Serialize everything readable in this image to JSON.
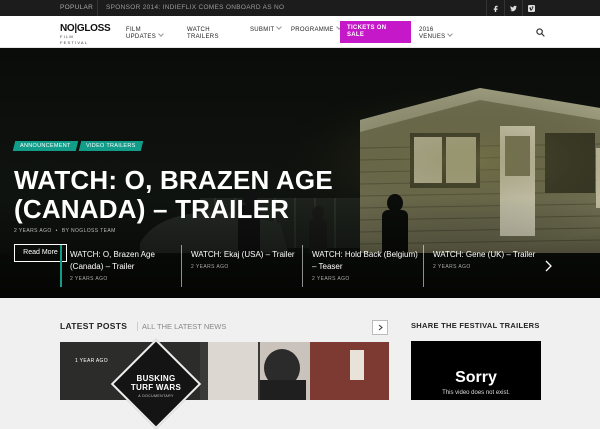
{
  "topbar": {
    "popular_label": "Popular",
    "ticker": "Sponsor 2014: IndieFlix comes onboard as NO",
    "social_icons": [
      "facebook-icon",
      "twitter-icon",
      "vimeo-icon"
    ]
  },
  "logo": {
    "line1": "NO|GLOSS",
    "line2": "FILM FESTIVAL"
  },
  "nav": {
    "items": [
      {
        "label": "Film Updates",
        "has_dropdown": true
      },
      {
        "label": "Watch Trailers",
        "has_dropdown": false
      },
      {
        "label": "Submit",
        "has_dropdown": true
      },
      {
        "label": "Programme",
        "has_dropdown": true
      },
      {
        "label": "2016 Venues",
        "has_dropdown": true
      }
    ],
    "tickets_label": "Tickets on sale",
    "accent_color": "#c519c9"
  },
  "hero": {
    "tags": [
      "Announcement",
      "Video Trailers"
    ],
    "tag_color": "#129c8a",
    "title": "WATCH: O, Brazen Age (Canada) – Trailer",
    "date": "2 years ago",
    "author": "By NoGloss Team",
    "read_more": "Read More"
  },
  "slides": [
    {
      "title": "WATCH: O, Brazen Age (Canada) – Trailer",
      "date": "2 years ago",
      "active": true
    },
    {
      "title": "WATCH: Ekaj (USA) – Trailer",
      "date": "2 years ago",
      "active": false
    },
    {
      "title": "WATCH: Hold Back (Belgium) – Teaser",
      "date": "2 years ago",
      "active": false
    },
    {
      "title": "WATCH: Gene (UK) – Trailer",
      "date": "2 years ago",
      "active": false
    }
  ],
  "latest": {
    "title": "Latest Posts",
    "subtitle": "All the latest news",
    "post_date": "1 year ago",
    "post_image_text": "BUSKING TURF WARS",
    "post_image_small": "A DOCUMENTARY"
  },
  "sidebar": {
    "title": "Share the Festival Trailers",
    "video_heading": "Sorry",
    "video_message": "This video does not exist."
  }
}
